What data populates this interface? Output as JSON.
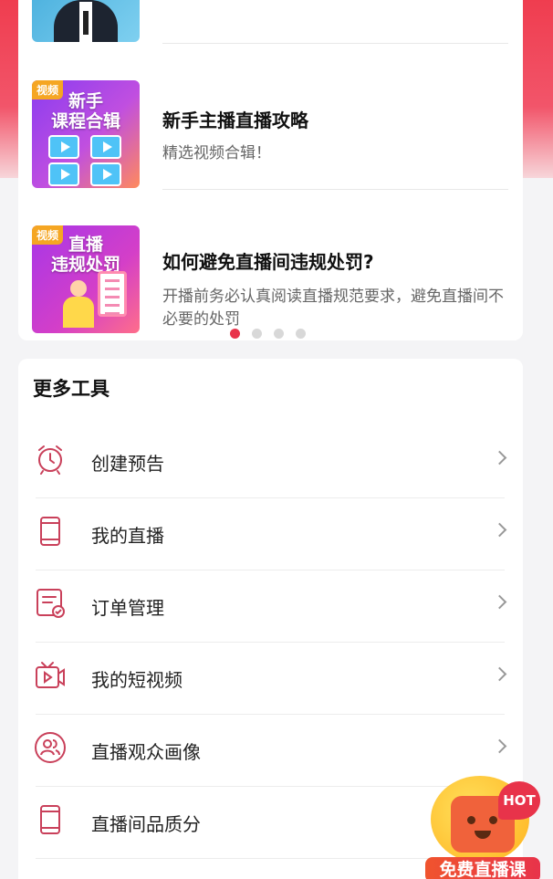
{
  "articles": [
    {
      "title": "",
      "desc": "",
      "badge": "",
      "thumb_title": ""
    },
    {
      "title": "新手主播直播攻略",
      "desc": "精选视频合辑！",
      "badge": "视频",
      "thumb_title": "新手\n课程合辑"
    },
    {
      "title": "如何避免直播间违规处罚?",
      "desc": "开播前务必认真阅读直播规范要求，避免直播间不必要的处罚",
      "badge": "视频",
      "thumb_title": "直播\n违规处罚"
    }
  ],
  "carousel": {
    "active_index": 0,
    "count": 4
  },
  "tools": {
    "title": "更多工具",
    "items": [
      {
        "label": "创建预告",
        "icon": "alarm-clock-icon"
      },
      {
        "label": "我的直播",
        "icon": "phone-icon"
      },
      {
        "label": "订单管理",
        "icon": "order-check-icon"
      },
      {
        "label": "我的短视频",
        "icon": "tv-video-icon"
      },
      {
        "label": "直播观众画像",
        "icon": "audience-icon"
      },
      {
        "label": "直播间品质分",
        "icon": "phone-icon"
      }
    ]
  },
  "hot_badge": {
    "tag": "HOT",
    "ribbon": "免费直播课"
  },
  "colors": {
    "accent": "#e8334a",
    "icon": "#c9405a"
  }
}
